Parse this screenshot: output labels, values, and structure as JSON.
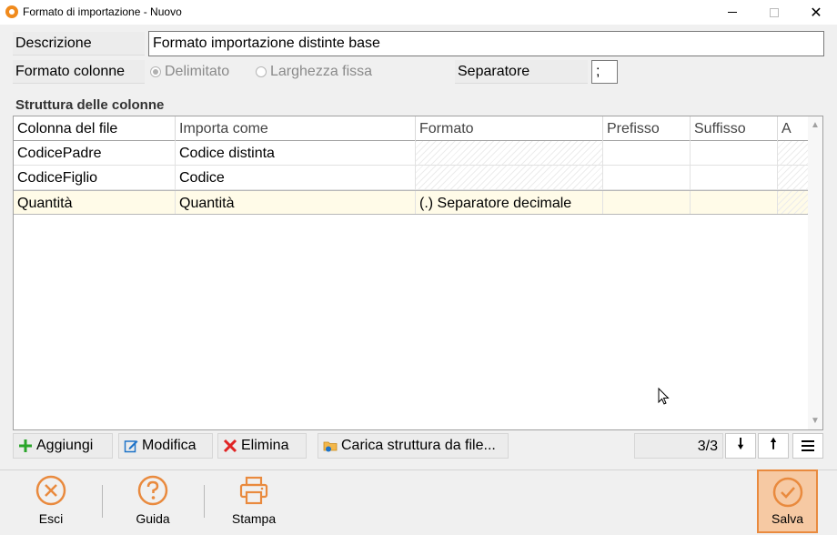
{
  "window": {
    "title": "Formato di importazione - Nuovo",
    "minimize": "—",
    "maximize": "☐",
    "close": "✕"
  },
  "form": {
    "descrizione_label": "Descrizione",
    "descrizione_value": "Formato importazione distinte base",
    "formato_colonne_label": "Formato colonne",
    "radio_delimitato": "Delimitato",
    "radio_larghezza": "Larghezza fissa",
    "radio_selected": "Delimitato",
    "separatore_label": "Separatore",
    "separatore_value": ";"
  },
  "section": {
    "title": "Struttura delle colonne"
  },
  "grid": {
    "columns": [
      "Colonna del file",
      "Importa come",
      "Formato",
      "Prefisso",
      "Suffisso",
      "A"
    ],
    "rows": [
      [
        "CodicePadre",
        "Codice distinta",
        "",
        "",
        "",
        ""
      ],
      [
        "CodiceFiglio",
        "Codice",
        "",
        "",
        "",
        ""
      ],
      [
        "Quantità",
        "Quantità",
        "(.) Separatore decimale",
        "",
        "",
        ""
      ]
    ],
    "selected_row": 2
  },
  "toolbar": {
    "add": "Aggiungi",
    "edit": "Modifica",
    "delete": "Elimina",
    "load": "Carica struttura da file...",
    "counter": "3/3"
  },
  "footer": {
    "exit": "Esci",
    "help": "Guida",
    "print": "Stampa",
    "save": "Salva"
  },
  "colors": {
    "accent": "#e98a3e",
    "save_bg": "#f6c9a3",
    "selected_row": "#fffbe8",
    "add_icon": "#2aa52a",
    "delete_icon": "#e02424",
    "edit_icon": "#1e73c8"
  }
}
